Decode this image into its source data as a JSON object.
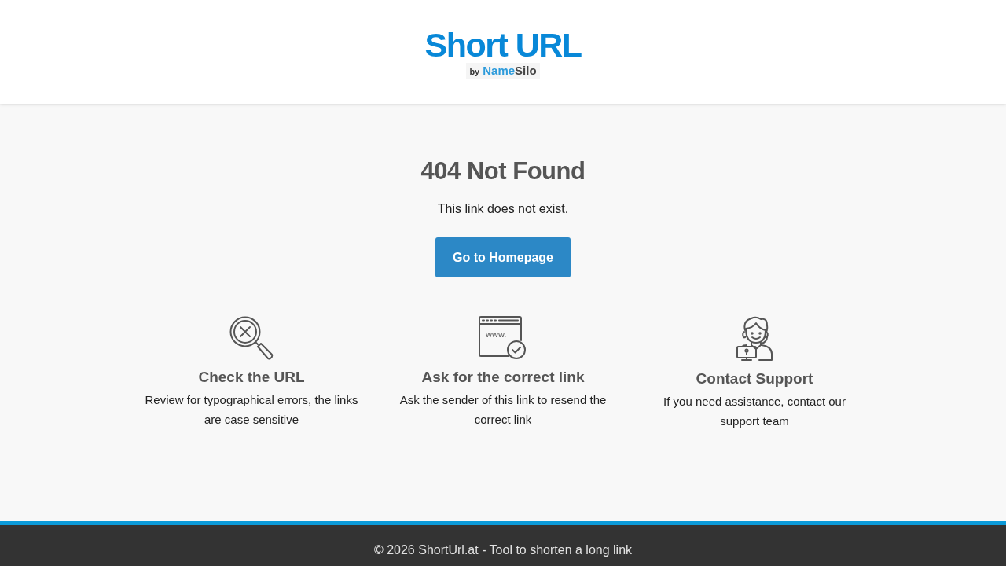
{
  "header": {
    "logo": {
      "title": "Short URL",
      "byline": "by",
      "brand_first": "Name",
      "brand_second": "Silo"
    }
  },
  "error": {
    "title": "404 Not Found",
    "message": "This link does not exist.",
    "button": "Go to Homepage"
  },
  "tips": [
    {
      "kind": "search",
      "title": "Check the URL",
      "text": "Review for typographical errors, the links are case sensitive"
    },
    {
      "kind": "browser",
      "icon_text": "www.",
      "title": "Ask for the correct link",
      "text": "Ask the sender of this link to resend the correct link"
    },
    {
      "kind": "support",
      "title": "Contact Support",
      "text": "If you need assistance, contact our support team"
    }
  ],
  "footer": {
    "text": "© 2026 ShortUrl.at - Tool to shorten a long link"
  }
}
